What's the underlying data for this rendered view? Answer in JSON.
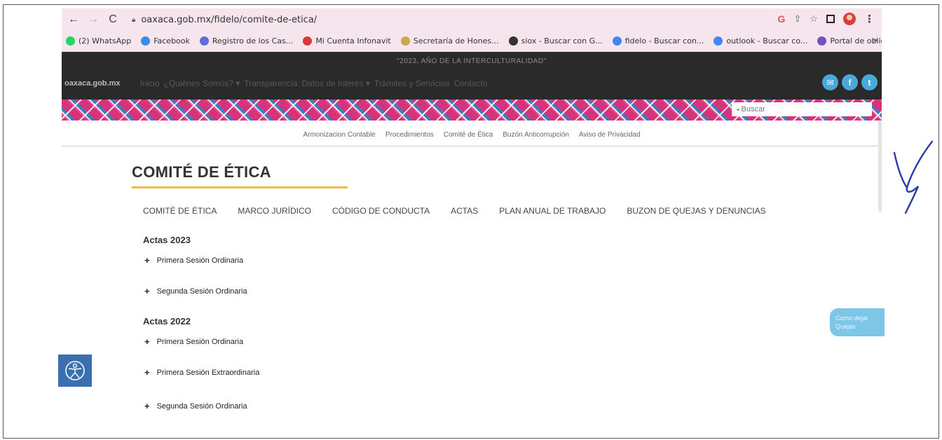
{
  "browser": {
    "url": "oaxaca.gob.mx/fidelo/comite-de-etica/",
    "bookmarks": [
      {
        "label": "(2) WhatsApp",
        "color": "#25d366"
      },
      {
        "label": "Facebook",
        "color": "#3b8be0"
      },
      {
        "label": "Registro de los Cas...",
        "color": "#5b6fd6"
      },
      {
        "label": "Mi Cuenta Infonavit",
        "color": "#d9363e"
      },
      {
        "label": "Secretaría de Hones...",
        "color": "#c9a94a"
      },
      {
        "label": "siox - Buscar con G...",
        "color": "#333333"
      },
      {
        "label": "fidelo - Buscar con...",
        "color": "#4285f4"
      },
      {
        "label": "outlook - Buscar co...",
        "color": "#4285f4"
      },
      {
        "label": "Portal de obligacio...",
        "color": "#7a4fc4"
      }
    ],
    "more": "»"
  },
  "site": {
    "slogan": "\"2023, AÑO DE LA INTERCULTURALIDAD\"",
    "logo": "oaxaca.gob.mx",
    "nav": [
      "Inicio",
      "¿Quiénes Somos? ▾",
      "Transparencia",
      "Datos de Interés ▾",
      "Trámites y Servicios",
      "Contacto"
    ],
    "socials": [
      "✉",
      "f",
      "t"
    ],
    "search_placeholder": "Buscar",
    "subnav": [
      "Armonizacion Contable",
      "Procedimientos",
      "Comité de Ética",
      "Buzón Anticorrupción",
      "Aviso de Privacidad"
    ]
  },
  "page": {
    "title": "COMITÉ DE ÉTICA",
    "tabs": [
      "COMITÉ DE ÉTICA",
      "MARCO JURÍDICO",
      "CÓDIGO DE CONDUCTA",
      "ACTAS",
      "PLAN ANUAL DE TRABAJO",
      "BUZON DE QUEJAS Y DENUNCIAS"
    ],
    "sections": [
      {
        "heading": "Actas 2023",
        "items": [
          "Primera Sesión Ordinaria",
          "Segunda Sesión Ordinaria"
        ]
      },
      {
        "heading": "Actas 2022",
        "items": [
          "Primera Sesión Ordinaria",
          "Primera Sesión Extraordinaria",
          "Segunda Sesión Ordinaria"
        ]
      }
    ]
  },
  "floating": {
    "line1": "Como dejar",
    "line2": "Quejas"
  },
  "colors": {
    "accent_yellow": "#f0c03a",
    "header_dark": "#2a2a2a",
    "social_blue": "#4aa9d9",
    "access_blue": "#3a6fb0"
  }
}
